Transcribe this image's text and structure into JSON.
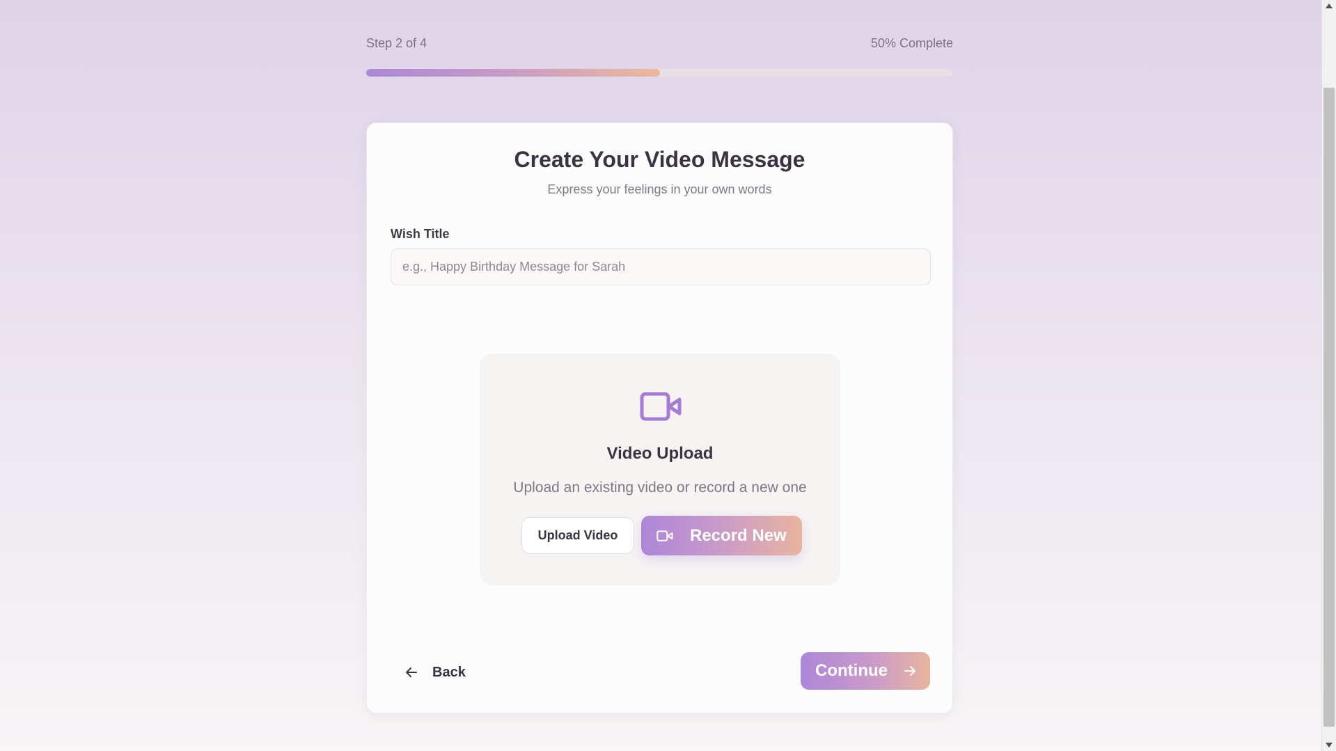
{
  "progress": {
    "step_label": "Step 2 of 4",
    "complete_label": "50% Complete",
    "fraction": 0.5
  },
  "card": {
    "title": "Create Your Video Message",
    "subtitle": "Express your feelings in your own words"
  },
  "wish_title": {
    "label": "Wish Title",
    "value": "",
    "placeholder": "e.g., Happy Birthday Message for Sarah"
  },
  "upload": {
    "icon": "video-camera-icon",
    "heading": "Video Upload",
    "description": "Upload an existing video or record a new one",
    "upload_button": "Upload Video",
    "record_button": "Record New"
  },
  "nav": {
    "back_label": "Back",
    "continue_label": "Continue"
  },
  "colors": {
    "accent_start": "#ad86d8",
    "accent_end": "#e9b49e",
    "icon_purple": "#a57bd3"
  }
}
